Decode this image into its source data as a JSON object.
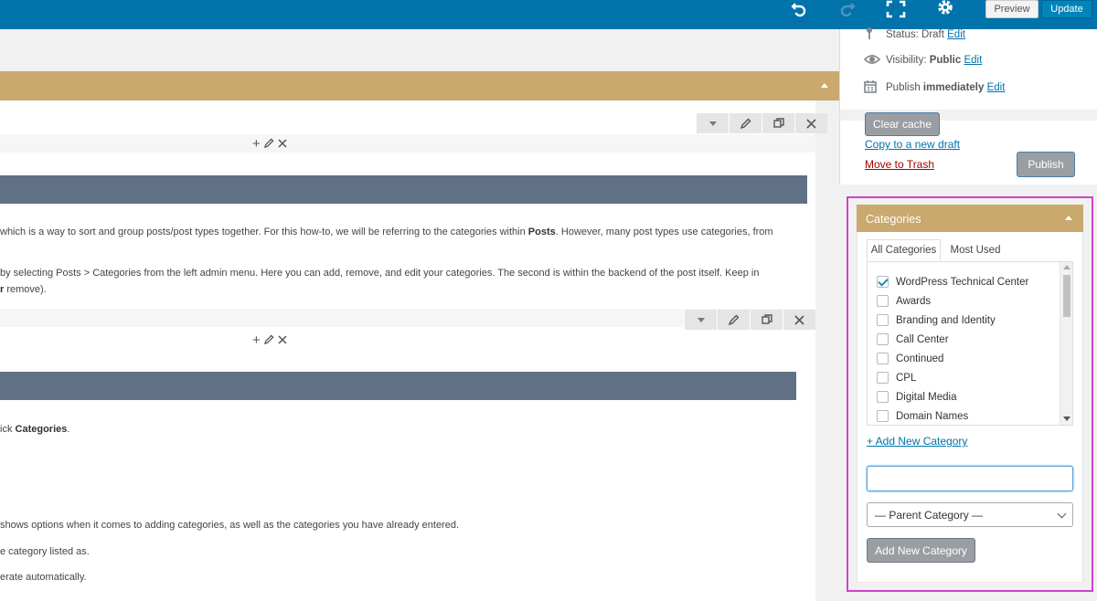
{
  "toolbar": {
    "preview_label": "Preview",
    "update_label": "Update",
    "icons": [
      "undo-icon",
      "redo-icon",
      "fullscreen-icon",
      "gear-icon"
    ]
  },
  "editor": {
    "paragraphs": {
      "p1": "which is a way to sort and group posts/post types together. For this how-to, we will be referring to the categories within",
      "p1_bold": "Posts",
      "p1_end": ". However, many post types use categories, from",
      "p2": "by selecting Posts > Categories from the left admin menu. Here you can add, remove, and edit your categories. The second is within the backend of the post itself. Keep in",
      "p2b_bold": "r",
      "p2b": " remove).",
      "p3": "ick",
      "p3_bold": "Categories",
      "p3_end": ".",
      "p4": "shows options when it comes to adding categories, as well as the categories you have already entered.",
      "p5": "e category listed as.",
      "p6": "erate automatically."
    }
  },
  "publish": {
    "status_label": "Status:",
    "status_value": "Draft",
    "visibility_label": "Visibility:",
    "visibility_value": "Public",
    "publish_label": "Publish",
    "publish_value": "immediately",
    "edit_link": "Edit",
    "clear_cache": "Clear cache",
    "copy_draft": "Copy to a new draft",
    "move_trash": "Move to Trash",
    "publish_button": "Publish"
  },
  "categories": {
    "title": "Categories",
    "tab_all": "All Categories",
    "tab_most_used": "Most Used",
    "items": [
      {
        "label": "WordPress Technical Center",
        "checked": true
      },
      {
        "label": "Awards",
        "checked": false
      },
      {
        "label": "Branding and Identity",
        "checked": false
      },
      {
        "label": "Call Center",
        "checked": false
      },
      {
        "label": "Continued",
        "checked": false
      },
      {
        "label": "CPL",
        "checked": false
      },
      {
        "label": "Digital Media",
        "checked": false
      },
      {
        "label": "Domain Names",
        "checked": false
      }
    ],
    "add_new_link": "+ Add New Category",
    "new_category_value": "",
    "parent_select": "— Parent Category —",
    "add_button": "Add New Category"
  },
  "colors": {
    "topbar": "#0073aa",
    "gold": "#c9a96e",
    "slate": "#607085",
    "highlight": "#cc44cc"
  }
}
